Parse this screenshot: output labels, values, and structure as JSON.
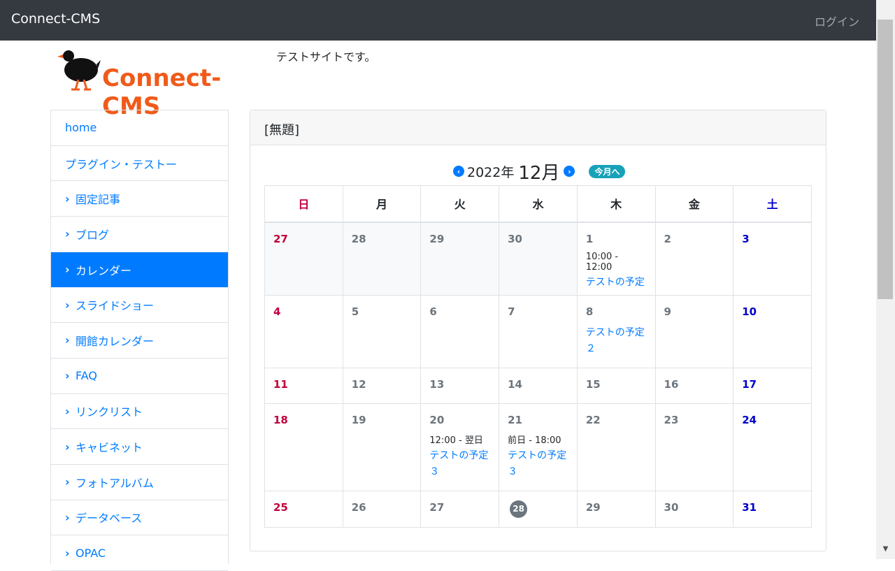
{
  "header": {
    "brand": "Connect-CMS",
    "login": "ログイン"
  },
  "site": {
    "logo_text": "Connect-CMS",
    "tagline": "テストサイトです。"
  },
  "sidebar": {
    "items": [
      {
        "label": "home",
        "chevron": false,
        "active": false
      },
      {
        "label": "プラグイン・テストー",
        "chevron": false,
        "active": false
      },
      {
        "label": "固定記事",
        "chevron": true,
        "active": false
      },
      {
        "label": "ブログ",
        "chevron": true,
        "active": false
      },
      {
        "label": "カレンダー",
        "chevron": true,
        "active": true
      },
      {
        "label": "スライドショー",
        "chevron": true,
        "active": false
      },
      {
        "label": "開館カレンダー",
        "chevron": true,
        "active": false
      },
      {
        "label": "FAQ",
        "chevron": true,
        "active": false
      },
      {
        "label": "リンクリスト",
        "chevron": true,
        "active": false
      },
      {
        "label": "キャビネット",
        "chevron": true,
        "active": false
      },
      {
        "label": "フォトアルバム",
        "chevron": true,
        "active": false
      },
      {
        "label": "データベース",
        "chevron": true,
        "active": false
      },
      {
        "label": "OPAC",
        "chevron": true,
        "active": false
      }
    ]
  },
  "panel": {
    "title": "[無題]"
  },
  "calendar": {
    "year": "2022年",
    "month": "12月",
    "today_button": "今月へ",
    "weekdays": [
      "日",
      "月",
      "火",
      "水",
      "木",
      "金",
      "土"
    ],
    "weeks": [
      [
        {
          "day": "27",
          "other": true
        },
        {
          "day": "28",
          "other": true
        },
        {
          "day": "29",
          "other": true
        },
        {
          "day": "30",
          "other": true
        },
        {
          "day": "1",
          "time": "10:00 - 12:00",
          "event": "テストの予定"
        },
        {
          "day": "2"
        },
        {
          "day": "3"
        }
      ],
      [
        {
          "day": "4"
        },
        {
          "day": "5"
        },
        {
          "day": "6"
        },
        {
          "day": "7"
        },
        {
          "day": "8",
          "event": "テストの予定２"
        },
        {
          "day": "9"
        },
        {
          "day": "10"
        }
      ],
      [
        {
          "day": "11"
        },
        {
          "day": "12"
        },
        {
          "day": "13"
        },
        {
          "day": "14"
        },
        {
          "day": "15"
        },
        {
          "day": "16"
        },
        {
          "day": "17"
        }
      ],
      [
        {
          "day": "18"
        },
        {
          "day": "19"
        },
        {
          "day": "20",
          "time": "12:00 - 翌日",
          "event": "テストの予定３"
        },
        {
          "day": "21",
          "time": "前日 - 18:00",
          "event": "テストの予定３"
        },
        {
          "day": "22"
        },
        {
          "day": "23"
        },
        {
          "day": "24"
        }
      ],
      [
        {
          "day": "25"
        },
        {
          "day": "26"
        },
        {
          "day": "27"
        },
        {
          "day": "28",
          "today": true
        },
        {
          "day": "29"
        },
        {
          "day": "30"
        },
        {
          "day": "31"
        }
      ]
    ]
  }
}
